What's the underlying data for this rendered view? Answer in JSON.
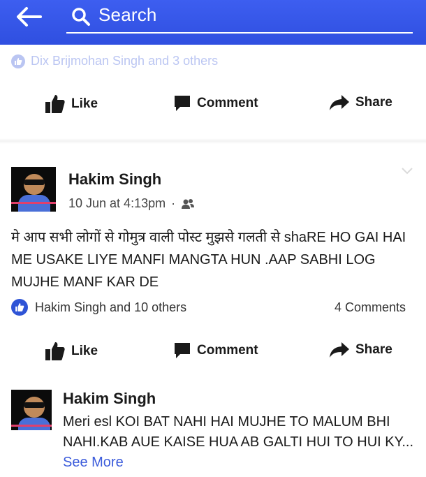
{
  "header": {
    "search_placeholder": "Search"
  },
  "previous_post": {
    "reactions_text": "Dix Brijmohan Singh and 3 others"
  },
  "actions": {
    "like": "Like",
    "comment": "Comment",
    "share": "Share"
  },
  "post": {
    "author": "Hakim Singh",
    "timestamp": "10 Jun at 4:13pm",
    "separator": "·",
    "text": "मे आप सभी लोगों से गोमुत्र वाली  पोस्ट मुझसे गलती से shaRE HO GAI HAI ME USAKE LIYE MANFI MANGTA HUN .AAP SABHI LOG MUJHE MANF KAR DE",
    "reactions_text": "Hakim Singh and 10 others",
    "comments_count": "4 Comments"
  },
  "comment": {
    "author": "Hakim Singh",
    "text": "Meri esl KOI BAT NAHI HAI MUJHE TO MALUM BHI NAHI.KAB AUE KAISE HUA AB GALTI HUI TO HUI KY...",
    "see_more": "See More"
  }
}
